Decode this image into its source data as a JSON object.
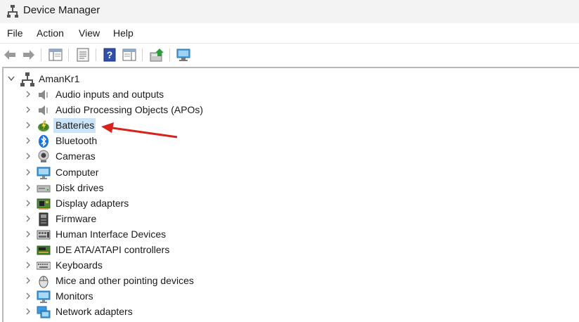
{
  "window": {
    "title": "Device Manager"
  },
  "menu": {
    "file": "File",
    "action": "Action",
    "view": "View",
    "help": "Help"
  },
  "tree": {
    "root_label": "AmanKr1",
    "items": [
      {
        "label": "Audio inputs and outputs",
        "icon": "speaker-icon"
      },
      {
        "label": "Audio Processing Objects (APOs)",
        "icon": "speaker-icon"
      },
      {
        "label": "Batteries",
        "icon": "battery-icon",
        "selected": true
      },
      {
        "label": "Bluetooth",
        "icon": "bluetooth-icon"
      },
      {
        "label": "Cameras",
        "icon": "camera-icon"
      },
      {
        "label": "Computer",
        "icon": "monitor-icon"
      },
      {
        "label": "Disk drives",
        "icon": "disk-drive-icon"
      },
      {
        "label": "Display adapters",
        "icon": "display-adapter-icon"
      },
      {
        "label": "Firmware",
        "icon": "firmware-icon"
      },
      {
        "label": "Human Interface Devices",
        "icon": "hid-icon"
      },
      {
        "label": "IDE ATA/ATAPI controllers",
        "icon": "ide-controller-icon"
      },
      {
        "label": "Keyboards",
        "icon": "keyboard-icon"
      },
      {
        "label": "Mice and other pointing devices",
        "icon": "mouse-icon"
      },
      {
        "label": "Monitors",
        "icon": "monitor-icon"
      },
      {
        "label": "Network adapters",
        "icon": "network-adapter-icon"
      }
    ]
  },
  "colors": {
    "selection": "#cce4f7",
    "annotation_arrow": "#d9221c",
    "bluetooth": "#1e73d8"
  }
}
